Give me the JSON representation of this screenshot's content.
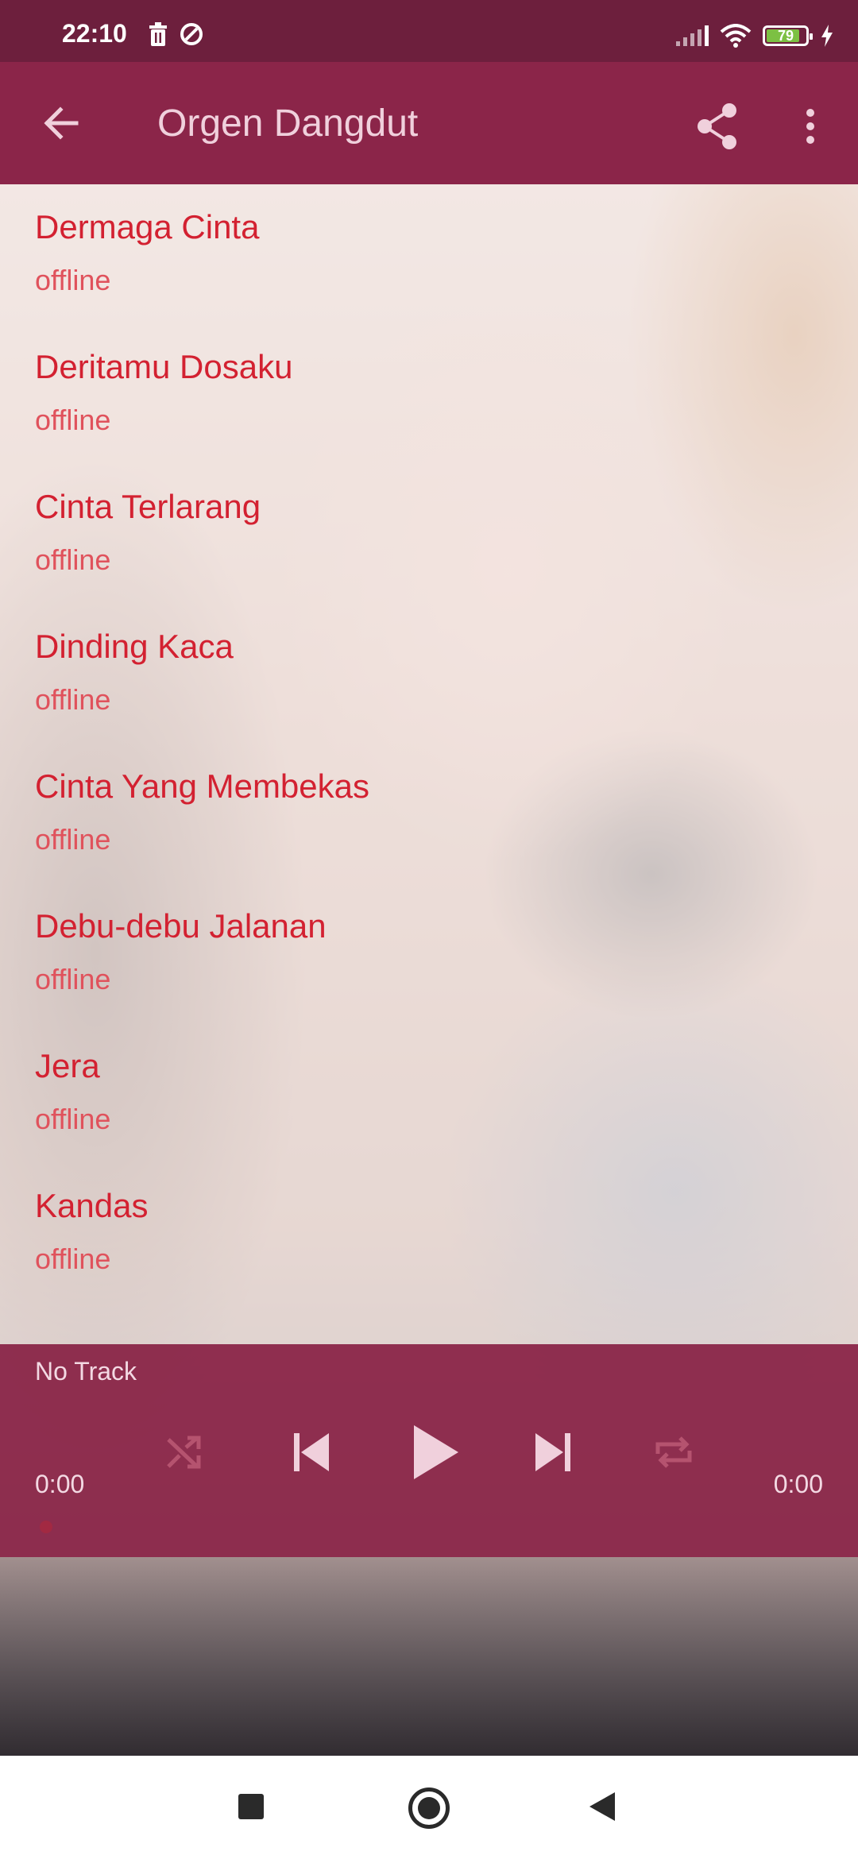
{
  "status_bar": {
    "time": "22:10",
    "battery": "79"
  },
  "app_bar": {
    "title": "Orgen Dangdut",
    "icons": [
      "arrow-left-icon",
      "share-icon",
      "more-vertical-icon"
    ]
  },
  "songs": [
    {
      "title": "Dermaga Cinta",
      "status": "offline"
    },
    {
      "title": "Deritamu Dosaku",
      "status": "offline"
    },
    {
      "title": "Cinta Terlarang",
      "status": "offline"
    },
    {
      "title": "Dinding Kaca",
      "status": "offline"
    },
    {
      "title": "Cinta Yang Membekas",
      "status": "offline"
    },
    {
      "title": "Debu-debu Jalanan",
      "status": "offline"
    },
    {
      "title": "Jera",
      "status": "offline"
    },
    {
      "title": "Kandas",
      "status": "offline"
    }
  ],
  "player": {
    "track": "No Track",
    "elapsed": "0:00",
    "duration": "0:00",
    "controls": [
      "shuffle-icon",
      "skip-previous-icon",
      "play-icon",
      "skip-next-icon",
      "repeat-icon"
    ]
  },
  "colors": {
    "primary": "#8b2549",
    "status_bar": "#6d1f3d",
    "song_title": "#d32131",
    "song_status": "#e0525c"
  }
}
